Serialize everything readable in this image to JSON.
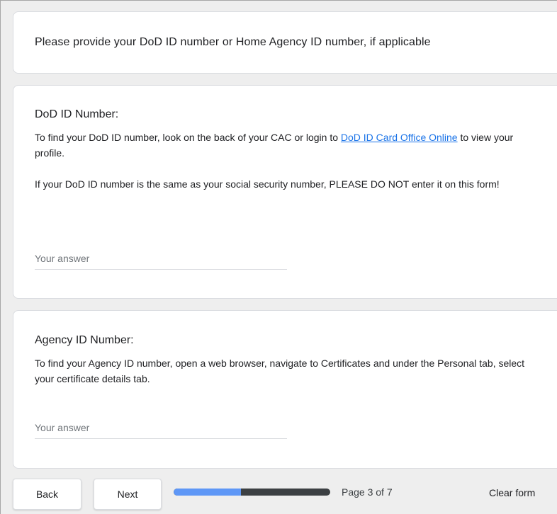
{
  "header": {
    "title": "Please provide your DoD ID number or Home Agency ID number, if applicable"
  },
  "questions": [
    {
      "label": "DoD ID Number:",
      "desc_before_link": "To find your DoD ID number, look on the back of your CAC or login to ",
      "link_text": "DoD ID Card Office Online",
      "desc_after_link": " to view your profile.",
      "warning": "If your DoD ID number is the same as your social security number, PLEASE DO NOT enter it on this form!",
      "placeholder": "Your answer",
      "value": ""
    },
    {
      "label": "Agency ID Number:",
      "description": "To find your Agency ID number, open a web browser, navigate to Certificates and under the Personal tab, select your certificate details tab.",
      "placeholder": "Your answer",
      "value": ""
    }
  ],
  "footer": {
    "back_label": "Back",
    "next_label": "Next",
    "progress_fraction": 0.42857,
    "page_text": "Page 3 of 7",
    "clear_label": "Clear form"
  },
  "colors": {
    "link": "#1a73e8",
    "progress_fill": "#5e97f6",
    "progress_track": "#3c4043"
  }
}
